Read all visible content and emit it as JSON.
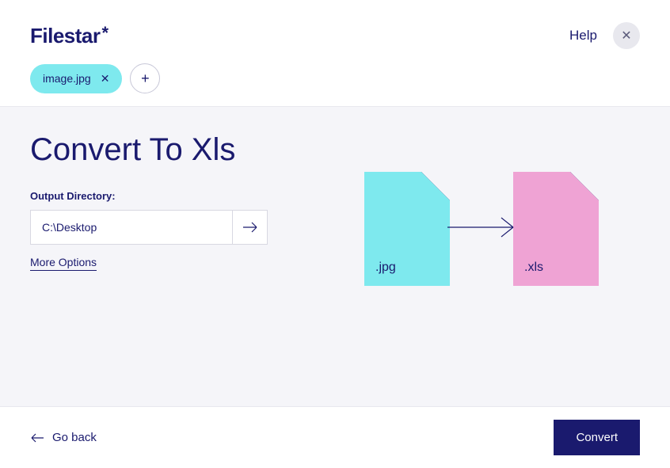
{
  "header": {
    "logo": "Filestar",
    "help_label": "Help"
  },
  "files": {
    "chip_name": "image.jpg"
  },
  "main": {
    "title": "Convert To Xls",
    "output_label": "Output Directory:",
    "output_value": "C:\\Desktop",
    "more_options": "More Options"
  },
  "visual": {
    "source_ext": ".jpg",
    "target_ext": ".xls"
  },
  "footer": {
    "go_back": "Go back",
    "convert": "Convert"
  }
}
